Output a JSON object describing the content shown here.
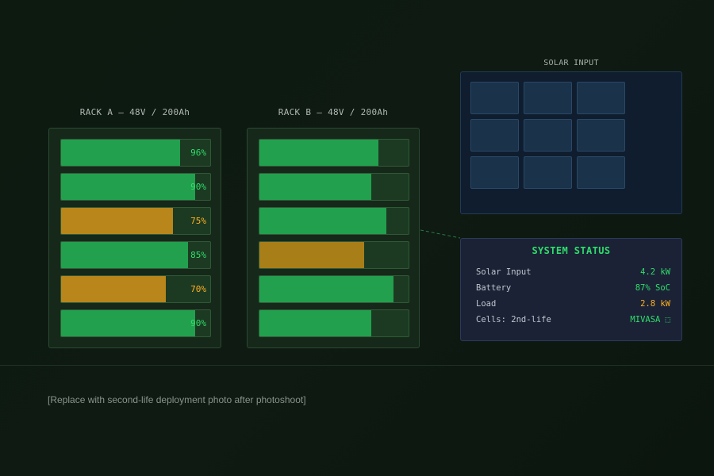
{
  "rack_a": {
    "title": "RACK A — 48V / 200Ah",
    "cells": [
      {
        "level": 0.8,
        "pct_label": "96%",
        "status": "green"
      },
      {
        "level": 0.9,
        "pct_label": "90%",
        "status": "green"
      },
      {
        "level": 0.75,
        "pct_label": "75%",
        "status": "amber"
      },
      {
        "level": 0.85,
        "pct_label": "85%",
        "status": "green"
      },
      {
        "level": 0.7,
        "pct_label": "70%",
        "status": "amber"
      },
      {
        "level": 0.9,
        "pct_label": "90%",
        "status": "green"
      }
    ]
  },
  "rack_b": {
    "title": "RACK B — 48V / 200Ah",
    "cells": [
      {
        "level": 0.8,
        "status": "green"
      },
      {
        "level": 0.75,
        "status": "green"
      },
      {
        "level": 0.85,
        "status": "green"
      },
      {
        "level": 0.7,
        "status": "amber"
      },
      {
        "level": 0.9,
        "status": "green"
      },
      {
        "level": 0.75,
        "status": "green"
      }
    ]
  },
  "solar": {
    "title": "SOLAR INPUT",
    "panel_rows": 3,
    "panel_cols": 3
  },
  "system_status": {
    "title": "SYSTEM STATUS",
    "rows": [
      {
        "label": "Solar Input",
        "value": "4.2 kW",
        "color": "green"
      },
      {
        "label": "Battery",
        "value": "87% SoC",
        "color": "green"
      },
      {
        "label": "Load",
        "value": "2.8 kW",
        "color": "amber"
      },
      {
        "label": "Cells: 2nd-life",
        "value": "MIVASA ⬚",
        "color": "green"
      }
    ]
  },
  "placeholder_note": "[Replace with second-life deployment photo after photoshoot]",
  "colors": {
    "green_fill": "#22a04e",
    "amber_fill": "#b8861a",
    "green_text": "#2ede6a",
    "amber_text": "#ffb020"
  }
}
